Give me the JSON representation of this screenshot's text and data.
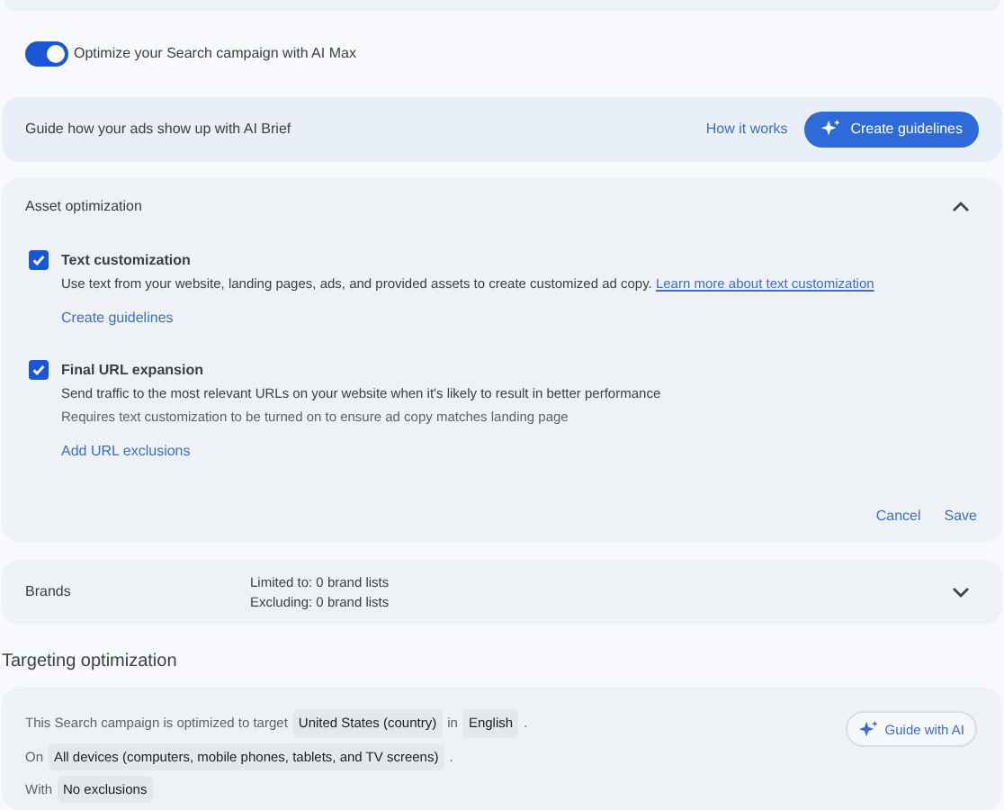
{
  "ai_max_toggle": {
    "label": "Optimize your Search campaign with AI Max",
    "on": true
  },
  "ai_brief": {
    "text": "Guide how your ads show up with AI Brief",
    "link": "How it works",
    "button": "Create guidelines"
  },
  "asset_optimization": {
    "title": "Asset optimization",
    "expanded": true,
    "options": [
      {
        "title": "Text customization",
        "checked": true,
        "description": "Use text from your website, landing pages, ads, and provided assets to create customized ad copy.",
        "learn_more": "Learn more about text customization",
        "link": "Create guidelines"
      },
      {
        "title": "Final URL expansion",
        "checked": true,
        "description": "Send traffic to the most relevant URLs on your website when it's likely to result in better performance",
        "note": "Requires text customization to be turned on to ensure ad copy matches landing page",
        "link": "Add URL exclusions"
      }
    ],
    "actions": [
      "Cancel",
      "Save"
    ]
  },
  "brands": {
    "title": "Brands",
    "expanded": false,
    "lines": [
      "Limited to: 0 brand lists",
      "Excluding: 0 brand lists"
    ]
  },
  "targeting": {
    "heading": "Targeting optimization",
    "button": "Guide with AI",
    "lines": [
      {
        "parts": [
          {
            "kind": "text",
            "text": "This Search campaign is optimized to target"
          },
          {
            "kind": "chip",
            "text": "United States (country)"
          },
          {
            "kind": "text",
            "text": "in"
          },
          {
            "kind": "chip",
            "text": "English"
          },
          {
            "kind": "text",
            "text": "."
          }
        ]
      },
      {
        "parts": [
          {
            "kind": "text",
            "text": "On"
          },
          {
            "kind": "chip",
            "text": "All devices (computers, mobile phones, tablets, and TV screens)"
          },
          {
            "kind": "text",
            "text": "."
          }
        ]
      },
      {
        "parts": [
          {
            "kind": "text",
            "text": "With"
          },
          {
            "kind": "chip",
            "text": "No exclusions"
          }
        ]
      }
    ]
  }
}
